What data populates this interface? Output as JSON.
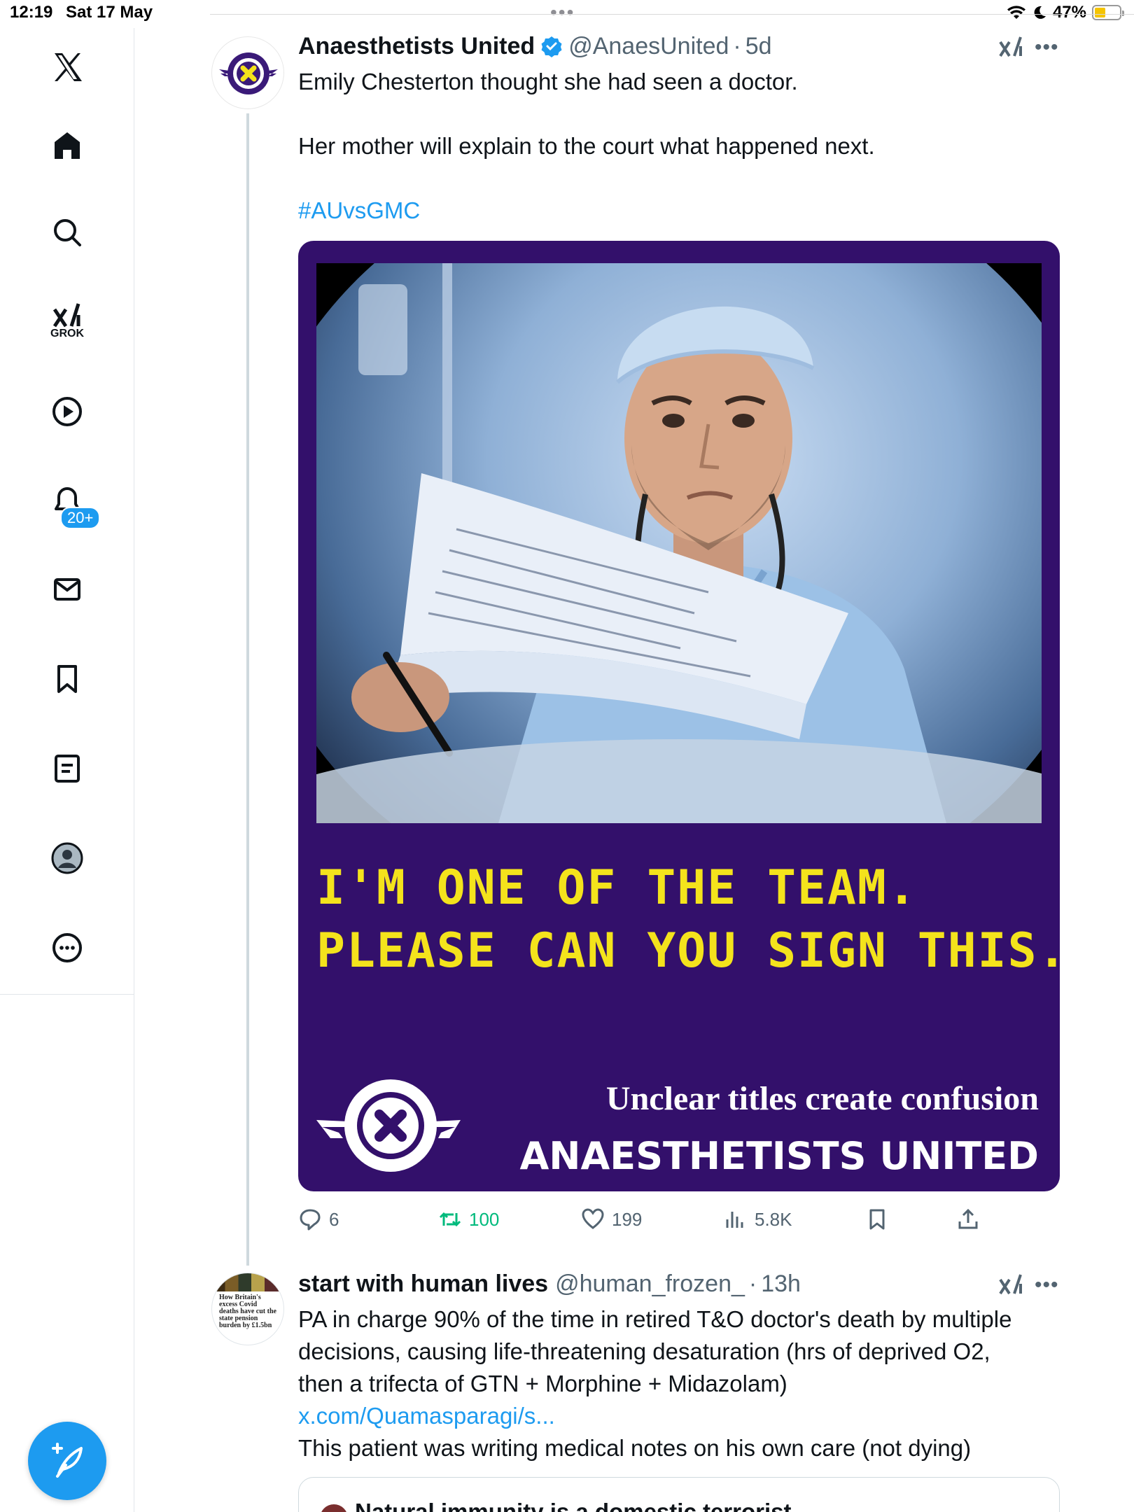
{
  "status_bar": {
    "time": "12:19",
    "date": "Sat 17 May",
    "battery": "47%",
    "battery_level": 0.47
  },
  "sidebar": {
    "items": [
      {
        "name": "x-logo",
        "label": ""
      },
      {
        "name": "home",
        "label": ""
      },
      {
        "name": "explore",
        "label": ""
      },
      {
        "name": "grok",
        "label": "GROK"
      },
      {
        "name": "videos",
        "label": ""
      },
      {
        "name": "notifications",
        "label": "",
        "badge": "20+"
      },
      {
        "name": "messages",
        "label": ""
      },
      {
        "name": "bookmarks",
        "label": ""
      },
      {
        "name": "lists",
        "label": ""
      },
      {
        "name": "profile",
        "label": ""
      },
      {
        "name": "more",
        "label": ""
      }
    ],
    "compose_icon": "feather-plus-icon"
  },
  "tweet1": {
    "name": "Anaesthetists United",
    "handle": "@AnaesUnited",
    "time": "5d",
    "lines": [
      "Emily Chesterton thought she had seen a doctor.",
      "Her mother will explain to the court what happened next."
    ],
    "hashtag": "#AUvsGMC",
    "media": {
      "headline_1": "I'M ONE OF THE TEAM.",
      "headline_2": "PLEASE CAN YOU SIGN THIS.",
      "caption_1": "Unclear titles create confusion",
      "caption_2": "ANAESTHETISTS UNITED",
      "background": "#33106b",
      "headline_color": "#f4e31c"
    },
    "stats": {
      "replies": "6",
      "reposts": "100",
      "likes": "199",
      "views": "5.8K"
    }
  },
  "tweet2": {
    "name": "start with human lives",
    "handle": "@human_frozen_",
    "time": "13h",
    "lines": [
      "PA in charge 90% of the time in retired T&O doctor's death by multiple",
      "decisions, causing life-threatening desaturation (hrs of deprived O2,",
      "then a trifecta of GTN + Morphine + Midazolam)"
    ],
    "link": "x.com/Quamasparagi/s...",
    "last_line": "This patient was writing medical notes on his own care (not dying)",
    "quote_title": "Natural immunity is a domestic terrorist",
    "avatar_text": "How Britain's excess Covid deaths have cut the state pension burden by £1.5bn"
  },
  "colors": {
    "accent": "#1d9bf0",
    "repost_green": "#00ba7c",
    "muted": "#536471"
  }
}
